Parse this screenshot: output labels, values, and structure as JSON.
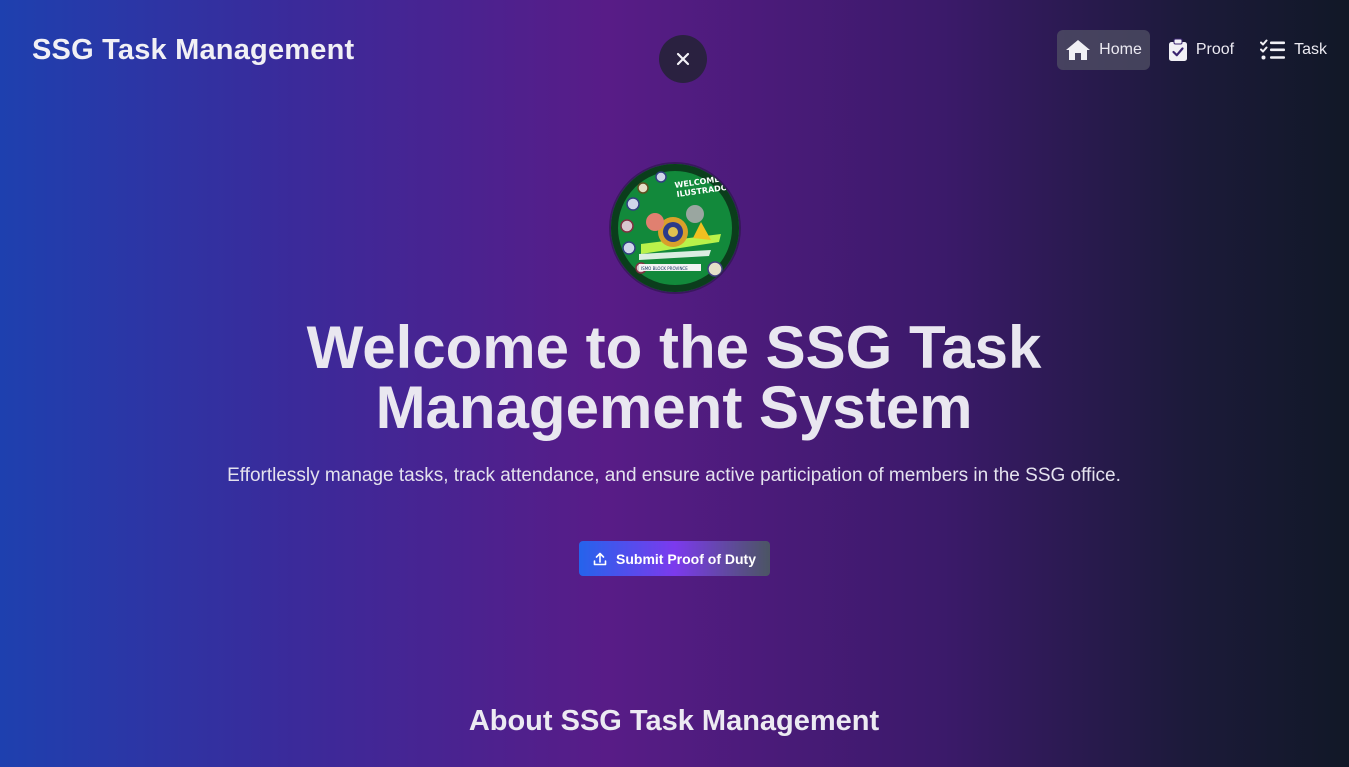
{
  "header": {
    "brand": "SSG Task Management",
    "nav": [
      {
        "label": "Home",
        "icon": "home-icon",
        "active": true
      },
      {
        "label": "Proof",
        "icon": "clipboard-check-icon",
        "active": false
      },
      {
        "label": "Task",
        "icon": "list-check-icon",
        "active": false
      }
    ],
    "close_icon": "close-icon"
  },
  "hero": {
    "image_text": "WELCOME BACK ILUSTRADOS!",
    "title": "Welcome to the SSG Task Management System",
    "subtitle": "Effortlessly manage tasks, track attendance, and ensure active participation of members in the SSG office.",
    "cta_label": "Submit Proof of Duty",
    "cta_icon": "upload-icon"
  },
  "about": {
    "title": "About SSG Task Management"
  },
  "colors": {
    "gradient_left": "#1e40af",
    "gradient_mid": "#581c87",
    "gradient_right": "#111827",
    "cta_start": "#2563eb",
    "cta_mid": "#7c3aed"
  }
}
